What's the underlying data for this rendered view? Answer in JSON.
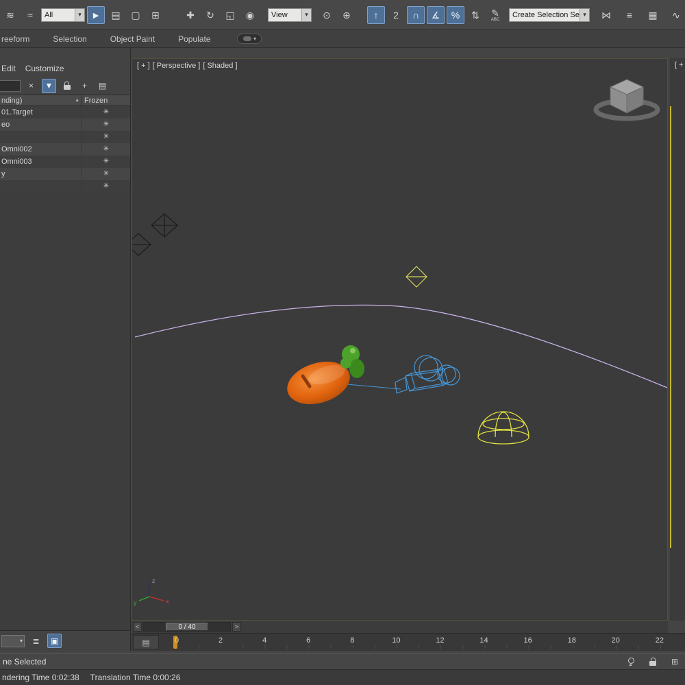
{
  "colors": {
    "accent_blue": "#4e7097",
    "carrot_orange": "#e8661a",
    "carrot_dark": "#8f3c0a",
    "leaf_green": "#4da22c",
    "leaf_green_dark": "#3c8a1e",
    "camera_blue": "#4596d8",
    "dome_yellow": "#e2e240",
    "arc_lavender": "#c8b2e8",
    "octa_yellow": "#d6d65a",
    "frame_marker": "#cf8f1c",
    "active_vp_yellow": "#c8b62a"
  },
  "icons": {
    "chevron_down": "▾",
    "clear": "×",
    "filter": "▼",
    "add": "+",
    "list": "▤",
    "layers": "≣",
    "dock": "▣",
    "grid": "⊞",
    "mini_curve": "▤",
    "sort_asc": "▲"
  },
  "toolbar": {
    "group1": [
      {
        "name": "select-and-link-button",
        "icon": "link-icon",
        "glyph": "≋",
        "active": false
      },
      {
        "name": "bind-to-space-warp-button",
        "icon": "space-warp-icon",
        "glyph": "≈",
        "active": false
      }
    ],
    "filter_dropdown": "All",
    "group2": [
      {
        "name": "select-object-button",
        "icon": "cursor-arrow-icon",
        "glyph": "►",
        "active": true
      },
      {
        "name": "select-by-name-button",
        "icon": "select-by-name-icon",
        "glyph": "▤",
        "active": false
      },
      {
        "name": "rectangular-selection-region-button",
        "icon": "selection-region-icon",
        "glyph": "▢",
        "active": false
      },
      {
        "name": "window-crossing-button",
        "icon": "window-crossing-icon",
        "glyph": "⊞",
        "active": false
      }
    ],
    "group3": [
      {
        "name": "select-and-move-button",
        "icon": "move-arrows-icon",
        "glyph": "✚",
        "active": false
      },
      {
        "name": "select-and-rotate-button",
        "icon": "rotate-icon",
        "glyph": "↻",
        "active": false
      },
      {
        "name": "select-and-scale-button",
        "icon": "scale-icon",
        "glyph": "◱",
        "active": false
      },
      {
        "name": "select-and-place-button",
        "icon": "place-icon",
        "glyph": "◉",
        "active": false
      }
    ],
    "coord_dropdown": "View",
    "group4": [
      {
        "name": "use-center-button",
        "icon": "use-center-icon",
        "glyph": "⊙",
        "active": false
      },
      {
        "name": "select-and-manipulate-button",
        "icon": "manipulate-icon",
        "glyph": "⊕",
        "active": false
      }
    ],
    "group5": [
      {
        "name": "keyboard-override-button",
        "icon": "up-arrow-icon",
        "glyph": "↑",
        "active": true
      },
      {
        "name": "snap-2d-button",
        "icon": "snap-2d-icon",
        "glyph": "2",
        "active": false
      },
      {
        "name": "snap-3d-button",
        "icon": "magnet-icon",
        "glyph": "∩",
        "active": true
      },
      {
        "name": "angle-snap-button",
        "icon": "angle-snap-icon",
        "glyph": "∡",
        "active": true
      },
      {
        "name": "percent-snap-button",
        "icon": "percent-icon",
        "glyph": "%",
        "active": true
      },
      {
        "name": "spinner-snap-button",
        "icon": "spinner-snap-icon",
        "glyph": "⇅",
        "active": false
      },
      {
        "name": "edit-named-selection-sets-button",
        "icon": "pencil-abc-icon",
        "glyph": "✎",
        "sub": "ABC",
        "active": false
      }
    ],
    "sets_dropdown": "Create Selection Se",
    "group6": [
      {
        "name": "mirror-button",
        "icon": "mirror-icon",
        "glyph": "⋈",
        "active": false
      },
      {
        "name": "align-button",
        "icon": "align-icon",
        "glyph": "≡",
        "active": false
      },
      {
        "name": "toggle-layer-explorer-button",
        "icon": "layers-grid-icon",
        "glyph": "▦",
        "active": false
      },
      {
        "name": "curve-editor-button",
        "icon": "curve-icon",
        "glyph": "∿",
        "active": false
      }
    ]
  },
  "ribbon": {
    "tabs": [
      {
        "label": "reeform",
        "name": "tab-freeform"
      },
      {
        "label": "Selection",
        "name": "tab-selection"
      },
      {
        "label": "Object Paint",
        "name": "tab-object-paint"
      },
      {
        "label": "Populate",
        "name": "tab-populate"
      }
    ]
  },
  "scene_explorer": {
    "menus": [
      {
        "label": "Edit",
        "name": "menu-edit"
      },
      {
        "label": "Customize",
        "name": "menu-customize"
      }
    ],
    "columns": {
      "name": "nding)",
      "frozen": "Frozen"
    },
    "rows": [
      {
        "name": "01.Target",
        "frozen_icon": "✳"
      },
      {
        "name": "eo",
        "frozen_icon": "✳"
      },
      {
        "name": "",
        "frozen_icon": "✳"
      },
      {
        "name": "Omni002",
        "frozen_icon": "✳"
      },
      {
        "name": "Omni003",
        "frozen_icon": "✳"
      },
      {
        "name": "y",
        "frozen_icon": "✳"
      },
      {
        "name": "",
        "frozen_icon": "✳"
      }
    ]
  },
  "viewport": {
    "label_menu": "[ + ]",
    "label_pov": "[ Perspective ]",
    "label_shading": "[ Shaded ]",
    "right_label": "[ + ]",
    "axis_x": "x",
    "axis_y": "y",
    "axis_z": "z"
  },
  "time_slider": {
    "prev": "<",
    "next": ">",
    "value": "0 / 40"
  },
  "track_bar": {
    "ticks": [
      "0",
      "2",
      "4",
      "6",
      "8",
      "10",
      "12",
      "14",
      "16",
      "18",
      "20",
      "22"
    ]
  },
  "status_bar": {
    "prompt": "ne Selected"
  },
  "macro_bar": {
    "render_time": "ndering Time  0:02:38",
    "translation_time": "Translation Time  0:00:26"
  }
}
